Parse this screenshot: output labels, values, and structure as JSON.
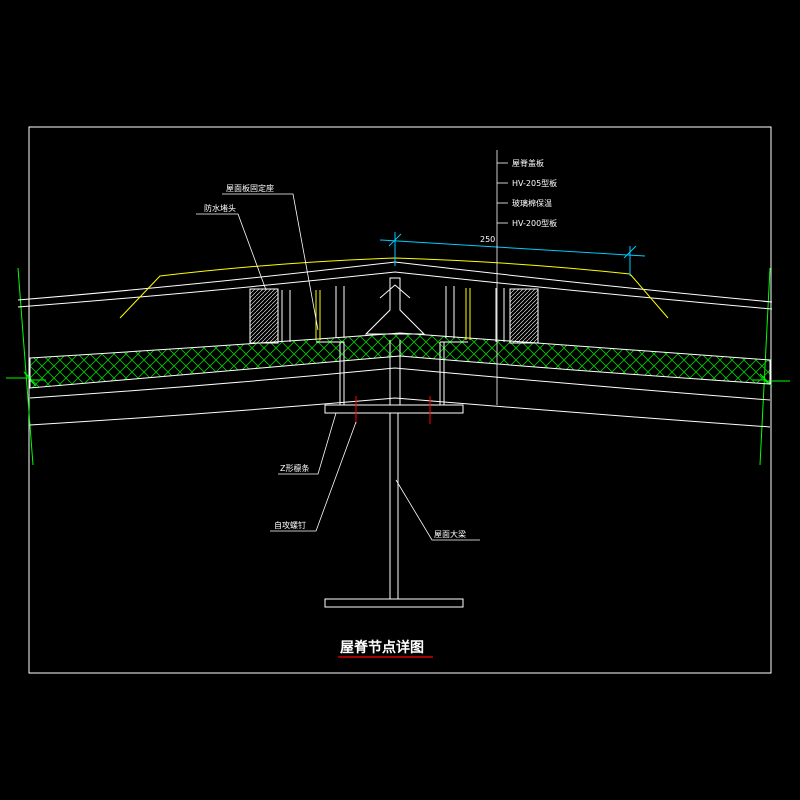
{
  "drawing": {
    "title": "屋脊节点详图",
    "dimension": "250",
    "labels": {
      "ridge_cap": "屋脊盖板",
      "hv_205": "HV-205型板",
      "glass_wool": "玻璃棉保温",
      "hv_200": "HV-200型板",
      "roof_panel_seat": "屋面板固定座",
      "waterproof_plug": "防水堵头",
      "z_purlin": "Z形檩条",
      "self_tapping_screw": "自攻螺钉",
      "roof_beam": "屋面大梁"
    }
  },
  "colors": {
    "background": "#000000",
    "frame": "#ffffff",
    "yellow": "#ffff00",
    "green": "#00ff00",
    "cyan": "#00ccff",
    "red": "#ff0000",
    "white": "#ffffff"
  }
}
